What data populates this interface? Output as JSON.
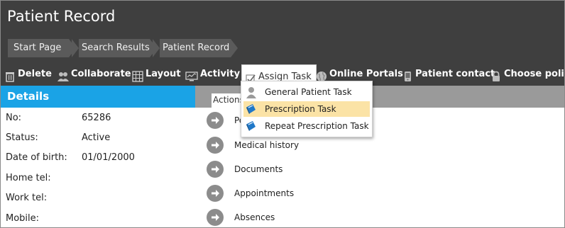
{
  "header": {
    "title": "Patient Record",
    "breadcrumb": [
      "Start Page",
      "Search Results",
      "Patient Record"
    ]
  },
  "toolbar": {
    "delete": "Delete",
    "collaborate": "Collaborate",
    "layout": "Layout",
    "activity": "Activity",
    "assign_task": "Assign Task",
    "online_portals": "Online Portals",
    "patient_contact": "Patient contact",
    "choose_policy": "Choose policy"
  },
  "dropdown": {
    "items": [
      "General Patient Task",
      "Prescription Task",
      "Repeat Prescription Task"
    ],
    "highlighted": "Prescription Task"
  },
  "details": {
    "heading": "Details",
    "fields": [
      {
        "label": "No:",
        "value": "65286"
      },
      {
        "label": "Status:",
        "value": "Active"
      },
      {
        "label": "Date of birth:",
        "value": "01/01/2000"
      },
      {
        "label": "Home tel:",
        "value": ""
      },
      {
        "label": "Work tel:",
        "value": ""
      },
      {
        "label": "Mobile:",
        "value": ""
      }
    ]
  },
  "actions": {
    "label": "Actions",
    "items": [
      "Pe",
      "Medical history",
      "Documents",
      "Appointments",
      "Absences"
    ]
  },
  "colors": {
    "header_bg": "#3f3f3f",
    "details_accent": "#1aa3e6",
    "highlight": "#fbe3a6"
  }
}
